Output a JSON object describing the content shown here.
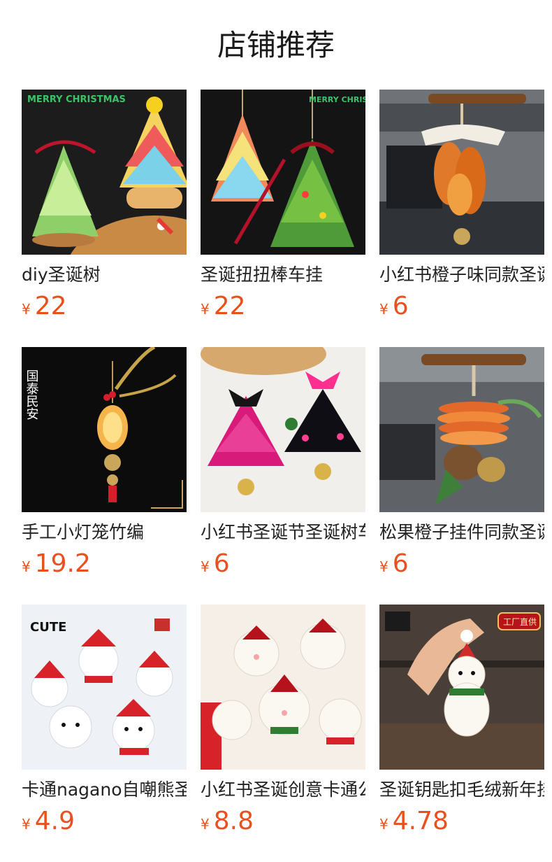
{
  "header": {
    "title": "店铺推荐"
  },
  "currency_symbol": "¥",
  "products": [
    {
      "name": "diy圣诞树",
      "price": "22",
      "image_icon": "christmas-tree-craft-icon",
      "image_text": "MERRY CHRISTMAS"
    },
    {
      "name": "圣诞扭扭棒车挂",
      "price": "22",
      "image_icon": "christmas-tree-ornament-icon",
      "image_text": "MERRY CHRISTMAS"
    },
    {
      "name": "小红书橙子味同款圣诞",
      "price": "6",
      "image_icon": "orange-car-hanger-icon",
      "image_text": ""
    },
    {
      "name": "手工小灯笼竹编",
      "price": "19.2",
      "image_icon": "lantern-icon",
      "image_text": "国泰民安"
    },
    {
      "name": "小红书圣诞节圣诞树车挂",
      "price": "6",
      "image_icon": "felt-tree-ornament-icon",
      "image_text": ""
    },
    {
      "name": "松果橙子挂件同款圣诞",
      "price": "6",
      "image_icon": "pinecone-orange-hanger-icon",
      "image_text": ""
    },
    {
      "name": "卡通nagano自嘲熊圣诞",
      "price": "4.9",
      "image_icon": "bear-plush-icon",
      "image_text": "CUTE"
    },
    {
      "name": "小红书圣诞创意卡通公仔",
      "price": "8.8",
      "image_icon": "sheep-plush-icon",
      "image_text": ""
    },
    {
      "name": "圣诞钥匙扣毛绒新年挂件",
      "price": "4.78",
      "image_icon": "bear-keychain-icon",
      "image_text": "工厂直供"
    }
  ]
}
